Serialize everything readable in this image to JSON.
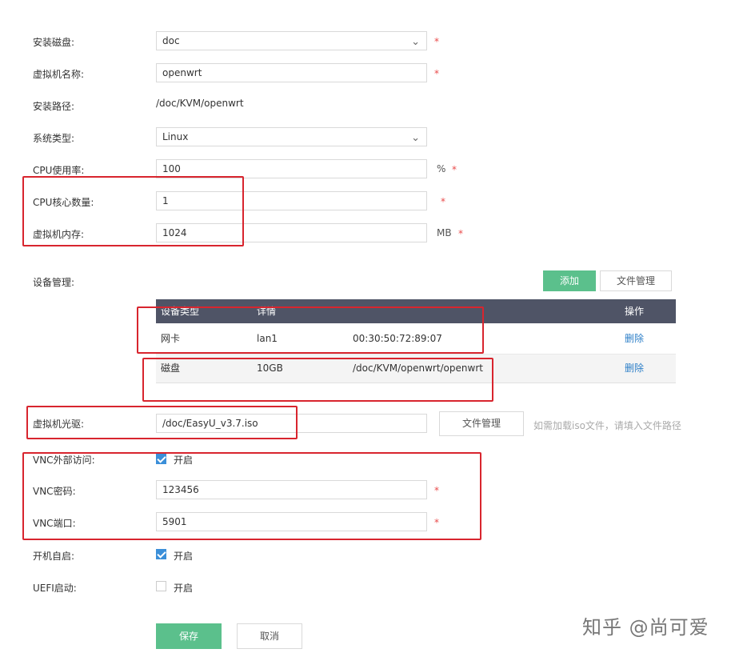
{
  "form": {
    "install_disk": {
      "label": "安装磁盘:",
      "value": "doc"
    },
    "vm_name": {
      "label": "虚拟机名称:",
      "value": "openwrt"
    },
    "install_path": {
      "label": "安装路径:",
      "value": "/doc/KVM/openwrt"
    },
    "os_type": {
      "label": "系统类型:",
      "value": "Linux"
    },
    "cpu_usage": {
      "label": "CPU使用率:",
      "value": "100",
      "unit": "%"
    },
    "cpu_cores": {
      "label": "CPU核心数量:",
      "value": "1"
    },
    "memory": {
      "label": "虚拟机内存:",
      "value": "1024",
      "unit": "MB"
    },
    "required_mark": "*"
  },
  "devices": {
    "label": "设备管理:",
    "add_button": "添加",
    "file_manage_button": "文件管理",
    "columns": [
      "设备类型",
      "详情",
      "操作"
    ],
    "rows": [
      {
        "type": "网卡",
        "detail1": "lan1",
        "detail2": "00:30:50:72:89:07",
        "action": "删除"
      },
      {
        "type": "磁盘",
        "detail1": "10GB",
        "detail2": "/doc/KVM/openwrt/openwrt",
        "action": "删除"
      }
    ]
  },
  "cdrom": {
    "label": "虚拟机光驱:",
    "value": "/doc/EasyU_v3.7.iso",
    "button": "文件管理",
    "hint": "如需加载iso文件，请填入文件路径"
  },
  "vnc": {
    "external_access": {
      "label": "VNC外部访问:",
      "checkbox_label": "开启",
      "checked": true
    },
    "password": {
      "label": "VNC密码:",
      "value": "123456"
    },
    "port": {
      "label": "VNC端口:",
      "value": "5901"
    }
  },
  "autostart": {
    "label": "开机自启:",
    "checkbox_label": "开启",
    "checked": true
  },
  "uefi": {
    "label": "UEFI启动:",
    "checkbox_label": "开启",
    "checked": false
  },
  "actions": {
    "save": "保存",
    "cancel": "取消"
  },
  "watermark": "知乎 @尚可爱",
  "colors": {
    "accent_green": "#5bc08c",
    "table_header": "#4f5466",
    "link": "#2d7fc8",
    "annotation_red": "#d8252e",
    "checkbox_blue": "#3b8fd9"
  }
}
